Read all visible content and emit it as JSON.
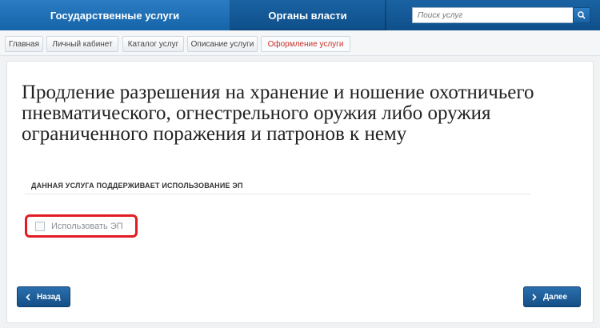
{
  "nav": {
    "tabs": [
      {
        "label": "Государственные услуги"
      },
      {
        "label": "Органы власти"
      }
    ]
  },
  "search": {
    "placeholder": "Поиск услуг"
  },
  "breadcrumb": {
    "items": [
      "Главная",
      "Личный кабинет",
      "Каталог услуг",
      "Описание услуги",
      "Оформление услуги"
    ]
  },
  "main": {
    "title": "Продление разрешения на хранение и ношение охотничьего пневматического, огнестрельного оружия либо оружия ограниченного поражения и патронов к нему",
    "ep_heading": "ДАННАЯ УСЛУГА ПОДДЕРЖИВАЕТ ИСПОЛЬЗОВАНИЕ ЭП",
    "ep_checkbox_label": "Использовать ЭП",
    "ep_checked": false
  },
  "buttons": {
    "back_label": "Назад",
    "next_label": "Далее"
  },
  "colors": {
    "nav_blue": "#0e4f8a",
    "highlight_red": "#e21c24",
    "current_crumb": "#c4322b"
  },
  "icons": {
    "search": "magnifier-icon",
    "back": "chevron-left-icon",
    "next": "chevron-right-icon"
  }
}
